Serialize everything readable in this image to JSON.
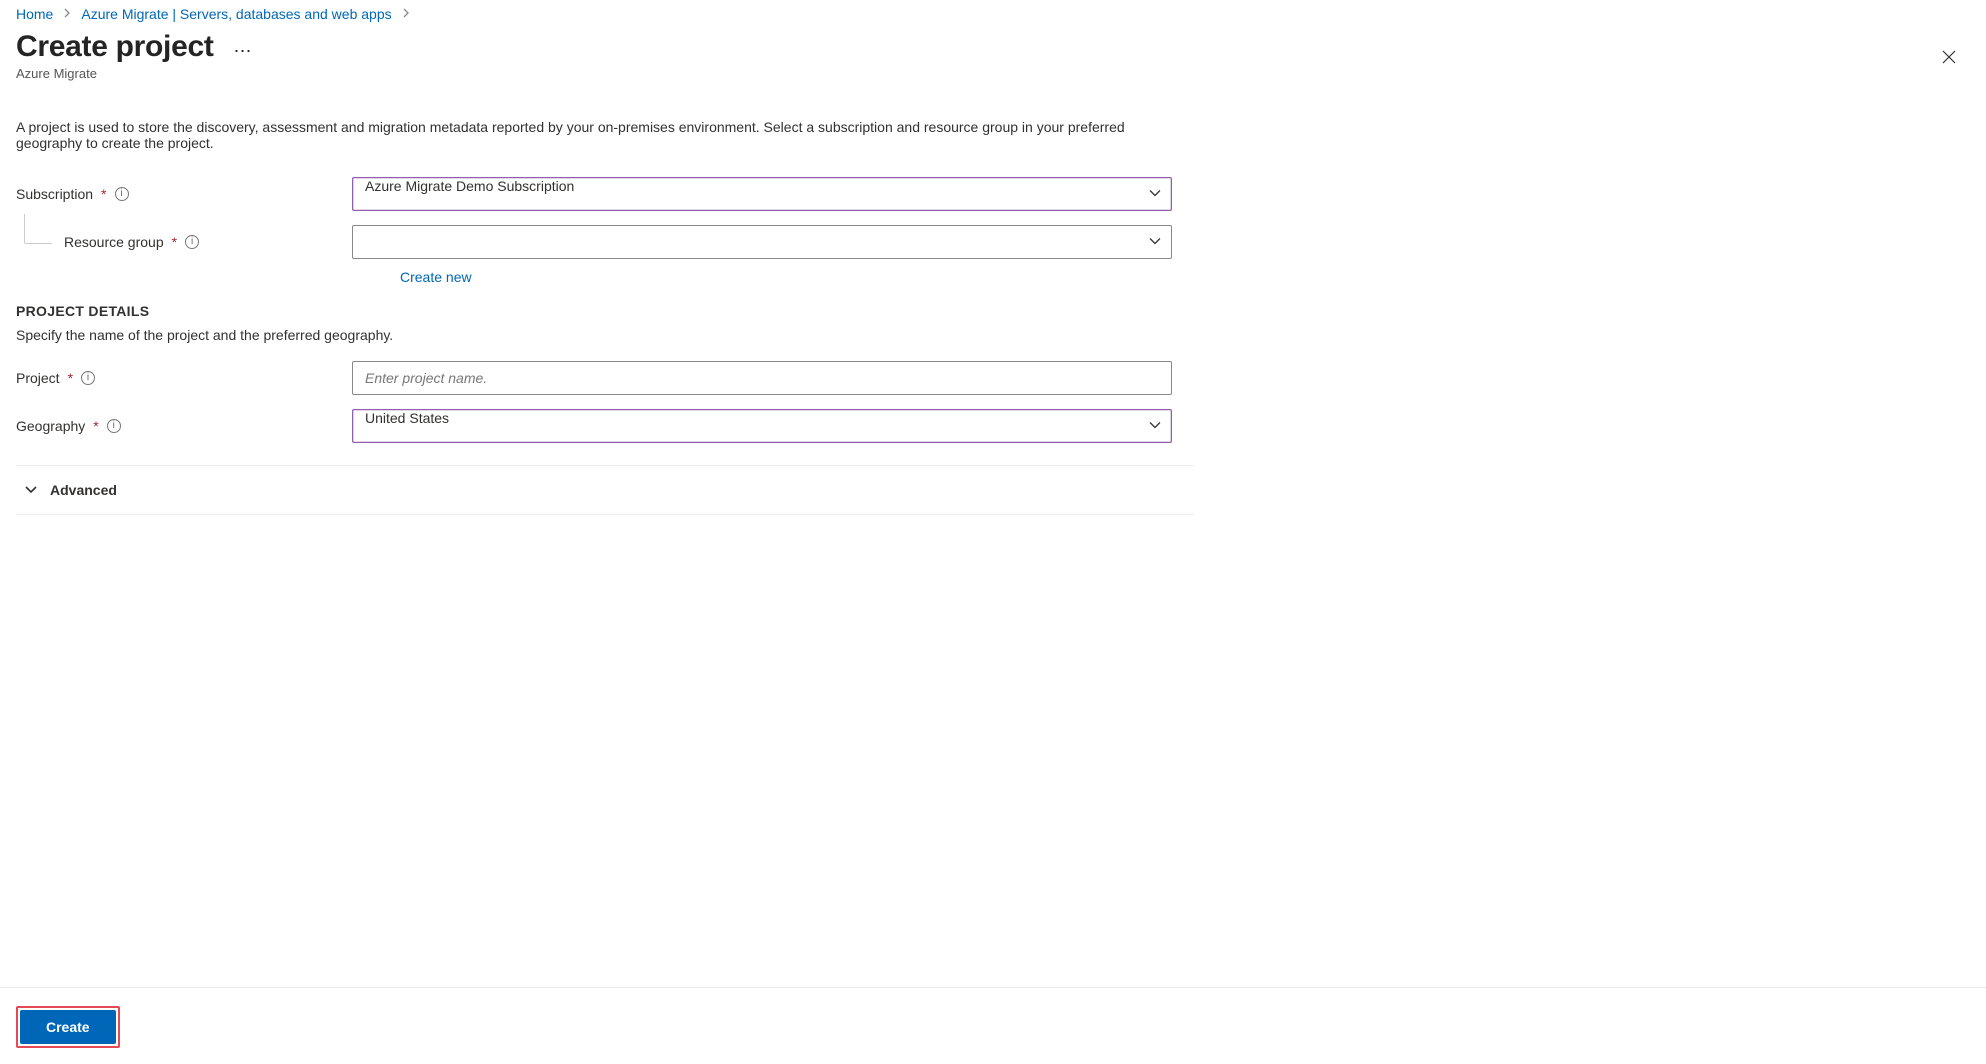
{
  "breadcrumb": {
    "items": [
      {
        "label": "Home"
      },
      {
        "label": "Azure Migrate | Servers, databases and web apps"
      }
    ]
  },
  "header": {
    "title": "Create project",
    "subtitle": "Azure Migrate"
  },
  "description": "A project is used to store the discovery, assessment and migration metadata reported by your on-premises environment. Select a subscription and resource group in your preferred geography to create the project.",
  "form": {
    "subscription": {
      "label": "Subscription",
      "value": "Azure Migrate Demo Subscription"
    },
    "resource_group": {
      "label": "Resource group",
      "value": "",
      "create_new_label": "Create new"
    },
    "project_details_heading": "PROJECT DETAILS",
    "project_details_desc": "Specify the name of the project and the preferred geography.",
    "project": {
      "label": "Project",
      "placeholder": "Enter project name.",
      "value": ""
    },
    "geography": {
      "label": "Geography",
      "value": "United States"
    },
    "advanced_label": "Advanced"
  },
  "footer": {
    "create_label": "Create"
  }
}
